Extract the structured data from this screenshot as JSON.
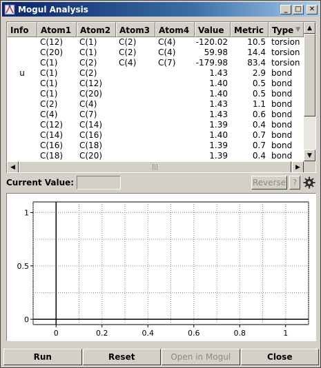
{
  "window": {
    "title": "Mogul Analysis",
    "minimize": "_",
    "maximize": "□",
    "close": "✕"
  },
  "table": {
    "columns": [
      "Info",
      "Atom1",
      "Atom2",
      "Atom3",
      "Atom4",
      "Value",
      "Metric",
      "Type"
    ],
    "rows": [
      {
        "info": "",
        "a1": "C(12)",
        "a2": "C(1)",
        "a3": "C(2)",
        "a4": "C(4)",
        "value": "-120.02",
        "metric": "10.5",
        "type": "torsion"
      },
      {
        "info": "",
        "a1": "C(20)",
        "a2": "C(1)",
        "a3": "C(2)",
        "a4": "C(4)",
        "value": "59.98",
        "metric": "14.4",
        "type": "torsion"
      },
      {
        "info": "",
        "a1": "C(1)",
        "a2": "C(2)",
        "a3": "C(4)",
        "a4": "C(7)",
        "value": "-179.98",
        "metric": "83.4",
        "type": "torsion"
      },
      {
        "info": "u",
        "a1": "C(1)",
        "a2": "C(2)",
        "a3": "",
        "a4": "",
        "value": "1.43",
        "metric": "2.9",
        "type": "bond"
      },
      {
        "info": "",
        "a1": "C(1)",
        "a2": "C(12)",
        "a3": "",
        "a4": "",
        "value": "1.40",
        "metric": "0.5",
        "type": "bond"
      },
      {
        "info": "",
        "a1": "C(1)",
        "a2": "C(20)",
        "a3": "",
        "a4": "",
        "value": "1.40",
        "metric": "0.5",
        "type": "bond"
      },
      {
        "info": "",
        "a1": "C(2)",
        "a2": "C(4)",
        "a3": "",
        "a4": "",
        "value": "1.43",
        "metric": "1.1",
        "type": "bond"
      },
      {
        "info": "",
        "a1": "C(4)",
        "a2": "C(7)",
        "a3": "",
        "a4": "",
        "value": "1.43",
        "metric": "0.6",
        "type": "bond"
      },
      {
        "info": "",
        "a1": "C(12)",
        "a2": "C(14)",
        "a3": "",
        "a4": "",
        "value": "1.39",
        "metric": "0.4",
        "type": "bond"
      },
      {
        "info": "",
        "a1": "C(14)",
        "a2": "C(16)",
        "a3": "",
        "a4": "",
        "value": "1.40",
        "metric": "0.7",
        "type": "bond"
      },
      {
        "info": "",
        "a1": "C(16)",
        "a2": "C(18)",
        "a3": "",
        "a4": "",
        "value": "1.39",
        "metric": "0.7",
        "type": "bond"
      },
      {
        "info": "",
        "a1": "C(18)",
        "a2": "C(20)",
        "a3": "",
        "a4": "",
        "value": "1.39",
        "metric": "0.4",
        "type": "bond"
      }
    ]
  },
  "current_value": {
    "label": "Current Value:",
    "value": ""
  },
  "toolbar": {
    "reverse_label": "Reverse",
    "help_label": "?"
  },
  "plot": {
    "x_ticks": [
      "0",
      "0.2",
      "0.4",
      "0.6",
      "0.8",
      "1"
    ],
    "y_ticks": [
      "0",
      "0.5",
      "1"
    ]
  },
  "buttons": {
    "run": "Run",
    "reset": "Reset",
    "open_in_mogul": "Open in Mogul",
    "close": "Close"
  }
}
